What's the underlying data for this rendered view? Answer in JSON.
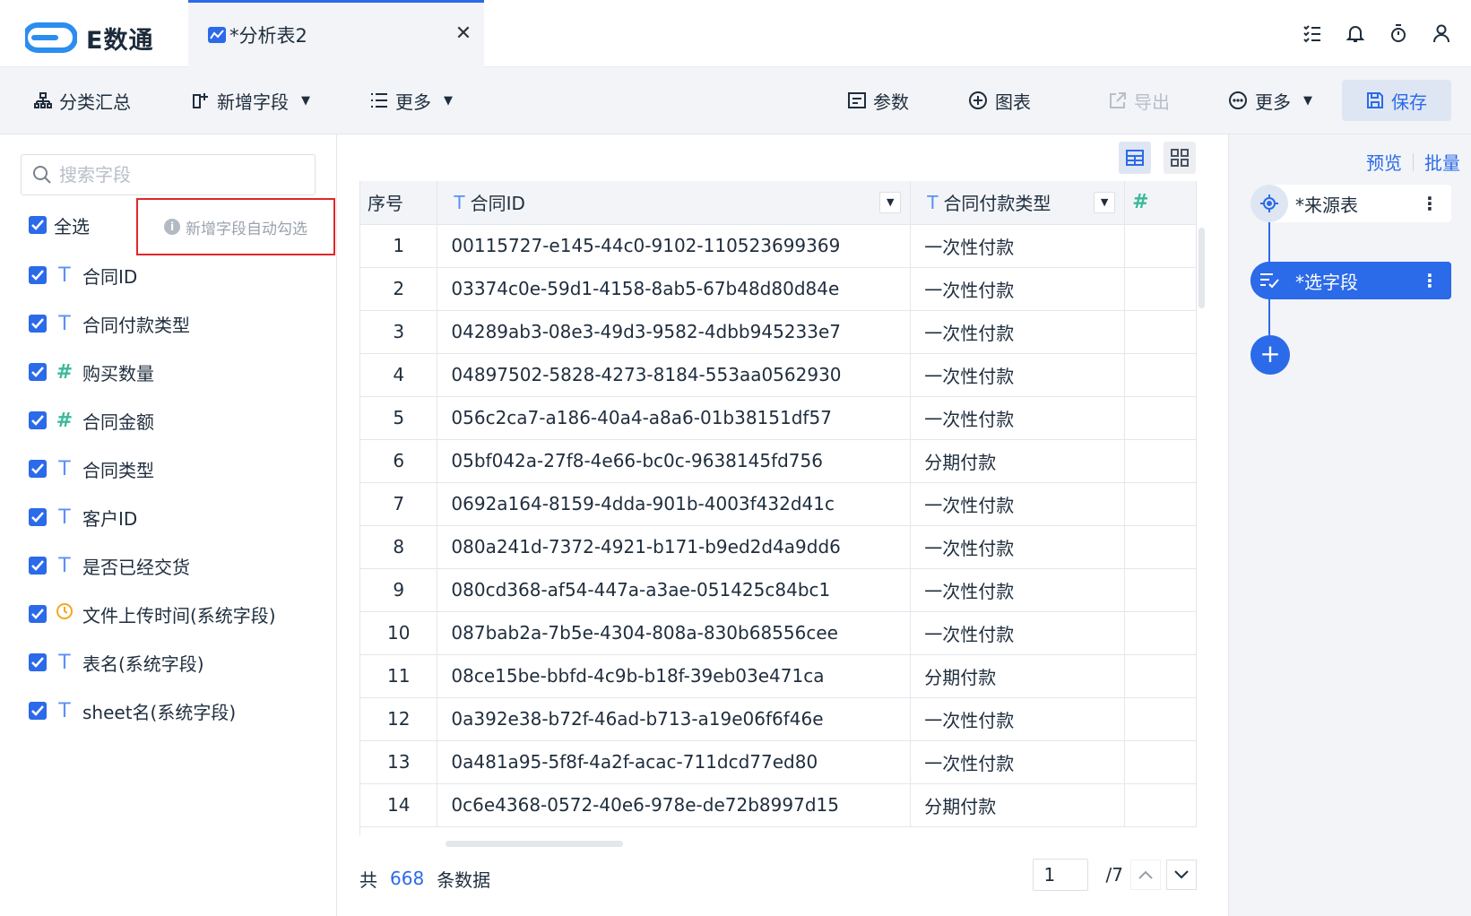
{
  "app": {
    "logo_text": "E数通"
  },
  "tab": {
    "label": "*分析表2",
    "close": "✕"
  },
  "toolbar": {
    "group_summary": "分类汇总",
    "add_field": "新增字段",
    "more_left": "更多",
    "params": "参数",
    "chart": "图表",
    "export": "导出",
    "more_right": "更多",
    "save": "保存"
  },
  "fields_panel": {
    "search_placeholder": "搜索字段",
    "select_all": "全选",
    "hint": "新增字段自动勾选",
    "fields": [
      {
        "type": "text",
        "name": "合同ID"
      },
      {
        "type": "text",
        "name": "合同付款类型"
      },
      {
        "type": "number",
        "name": "购买数量"
      },
      {
        "type": "number",
        "name": "合同金额"
      },
      {
        "type": "text",
        "name": "合同类型"
      },
      {
        "type": "text",
        "name": "客户ID"
      },
      {
        "type": "text",
        "name": "是否已经交货"
      },
      {
        "type": "time",
        "name": "文件上传时间(系统字段)"
      },
      {
        "type": "text",
        "name": "表名(系统字段)"
      },
      {
        "type": "text",
        "name": "sheet名(系统字段)"
      }
    ]
  },
  "table": {
    "headers": [
      "序号",
      "合同ID",
      "合同付款类型",
      "#"
    ],
    "rows": [
      [
        "1",
        "00115727-e145-44c0-9102-110523699369",
        "一次性付款"
      ],
      [
        "2",
        "03374c0e-59d1-4158-8ab5-67b48d80d84e",
        "一次性付款"
      ],
      [
        "3",
        "04289ab3-08e3-49d3-9582-4dbb945233e7",
        "一次性付款"
      ],
      [
        "4",
        "04897502-5828-4273-8184-553aa0562930",
        "一次性付款"
      ],
      [
        "5",
        "056c2ca7-a186-40a4-a8a6-01b38151df57",
        "一次性付款"
      ],
      [
        "6",
        "05bf042a-27f8-4e66-bc0c-9638145fd756",
        "分期付款"
      ],
      [
        "7",
        "0692a164-8159-4dda-901b-4003f432d41c",
        "一次性付款"
      ],
      [
        "8",
        "080a241d-7372-4921-b171-b9ed2d4a9dd6",
        "一次性付款"
      ],
      [
        "9",
        "080cd368-af54-447a-a3ae-051425c84bc1",
        "一次性付款"
      ],
      [
        "10",
        "087bab2a-7b5e-4304-808a-830b68556cee",
        "一次性付款"
      ],
      [
        "11",
        "08ce15be-bbfd-4c9b-b18f-39eb03e471ca",
        "分期付款"
      ],
      [
        "12",
        "0a392e38-b72f-46ad-b713-a19e06f6f46e",
        "一次性付款"
      ],
      [
        "13",
        "0a481a95-5f8f-4a2f-acac-711dcd77ed80",
        "一次性付款"
      ],
      [
        "14",
        "0c6e4368-0572-40e6-978e-de72b8997d15",
        "分期付款"
      ]
    ]
  },
  "footer": {
    "prefix": "共",
    "count": "668",
    "suffix": "条数据",
    "page": "1",
    "total_pages": "/7"
  },
  "steps_panel": {
    "preview": "预览",
    "batch": "批量",
    "steps": [
      "*来源表",
      "*选字段"
    ],
    "add": "+"
  },
  "colors": {
    "accent": "#2b6ae8",
    "number_type": "#3cb99a",
    "text_type": "#5b8ff9",
    "hint_border": "#e0262b"
  }
}
